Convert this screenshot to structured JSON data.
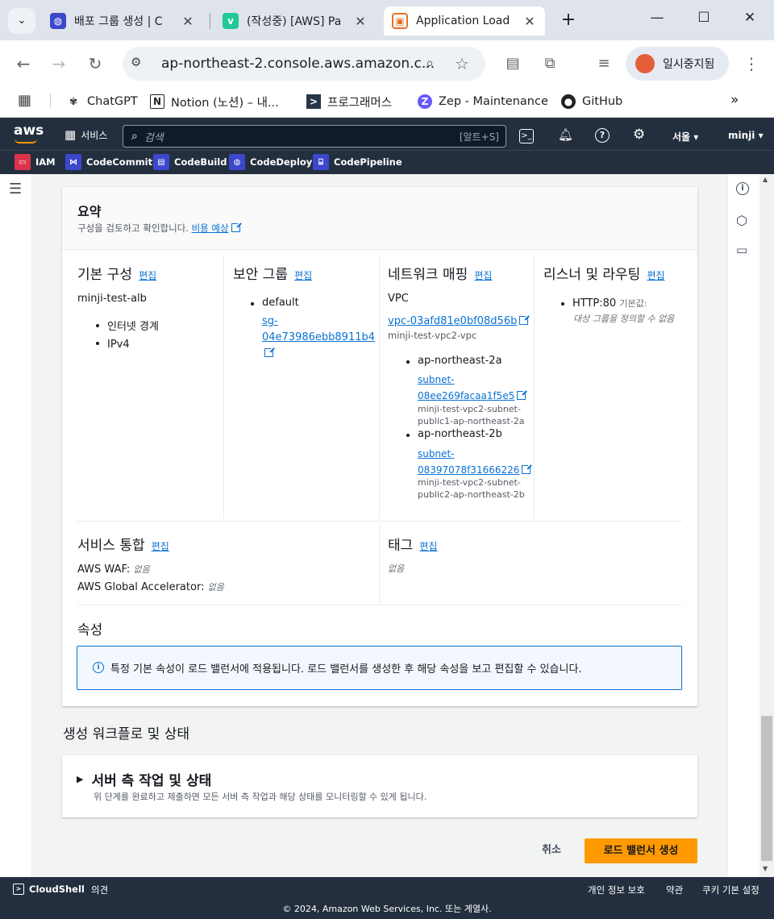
{
  "browser": {
    "tabs": [
      {
        "title": "배포 그룹 생성 | C"
      },
      {
        "title": "(작성중) [AWS] Pa"
      },
      {
        "title": "Application Load"
      }
    ],
    "url": "ap-northeast-2.console.aws.amazon.c...",
    "profile_label": "일시중지됨",
    "bookmarks": [
      "ChatGPT",
      "Notion (노션) – 내...",
      "프로그래머스",
      "Zep - Maintenance",
      "GitHub"
    ]
  },
  "aws": {
    "logo": "aws",
    "services_label": "서비스",
    "search_placeholder": "검색",
    "search_shortcut": "[알트+S]",
    "region": "서울",
    "user": "minji",
    "favorites": [
      "IAM",
      "CodeCommit",
      "CodeBuild",
      "CodeDeploy",
      "CodePipeline"
    ]
  },
  "summary": {
    "title": "요약",
    "subtitle": "구성을 검토하고 확인합니다.",
    "cost_link": "비용 예상",
    "edit_label": "편집",
    "basic": {
      "title": "기본 구성",
      "name": "minji-test-alb",
      "items": [
        "인터넷 경계",
        "IPv4"
      ]
    },
    "security": {
      "title": "보안 그룹",
      "item": "default",
      "sg_line1": "sg-",
      "sg_line2": "04e73986ebb8911b4"
    },
    "network": {
      "title": "네트워크 매핑",
      "vpc_label": "VPC",
      "vpc_id": "vpc-03afd81e0bf08d56b",
      "vpc_name": "minji-test-vpc2-vpc",
      "subnets": [
        {
          "az": "ap-northeast-2a",
          "id1": "subnet-",
          "id2": "08ee269facaa1f5e5",
          "name1": "minji-test-vpc2-subnet-",
          "name2": "public1-ap-northeast-2a"
        },
        {
          "az": "ap-northeast-2b",
          "id1": "subnet-",
          "id2": "08397078f31666226",
          "name1": "minji-test-vpc2-subnet-",
          "name2": "public2-ap-northeast-2b"
        }
      ]
    },
    "listener": {
      "title": "리스너 및 라우팅",
      "item": "HTTP:80",
      "default_label": "기본값:",
      "default_value": "대상 그룹을 정의할 수 없음"
    },
    "integration": {
      "title": "서비스 통합",
      "waf_label": "AWS WAF:",
      "waf_value": "없음",
      "ga_label": "AWS Global Accelerator:",
      "ga_value": "없음"
    },
    "tags": {
      "title": "태그",
      "value": "없음"
    },
    "attributes": {
      "title": "속성",
      "info": "특정 기본 속성이 로드 밸런서에 적용됩니다. 로드 밸런서를 생성한 후 해당 속성을 보고 편집할 수 있습니다."
    }
  },
  "workflow": {
    "title": "생성 워크플로 및 상태",
    "panel_title": "서버 측 작업 및 상태",
    "panel_desc": "위 단계를 완료하고 제출하면 모든 서버 측 작업과 해당 상태를 모니터링할 수 있게 됩니다."
  },
  "actions": {
    "cancel": "취소",
    "create": "로드 밸런서 생성"
  },
  "footer": {
    "cloudshell": "CloudShell",
    "feedback": "의견",
    "privacy": "개인 정보 보호",
    "terms": "약관",
    "cookies": "쿠키 기본 설정",
    "copyright": "© 2024, Amazon Web Services, Inc. 또는 계열사."
  },
  "colors": {
    "aws_nav": "#232f3e",
    "primary": "#ff9900",
    "link": "#0972d3",
    "info_border": "#0972d3"
  }
}
